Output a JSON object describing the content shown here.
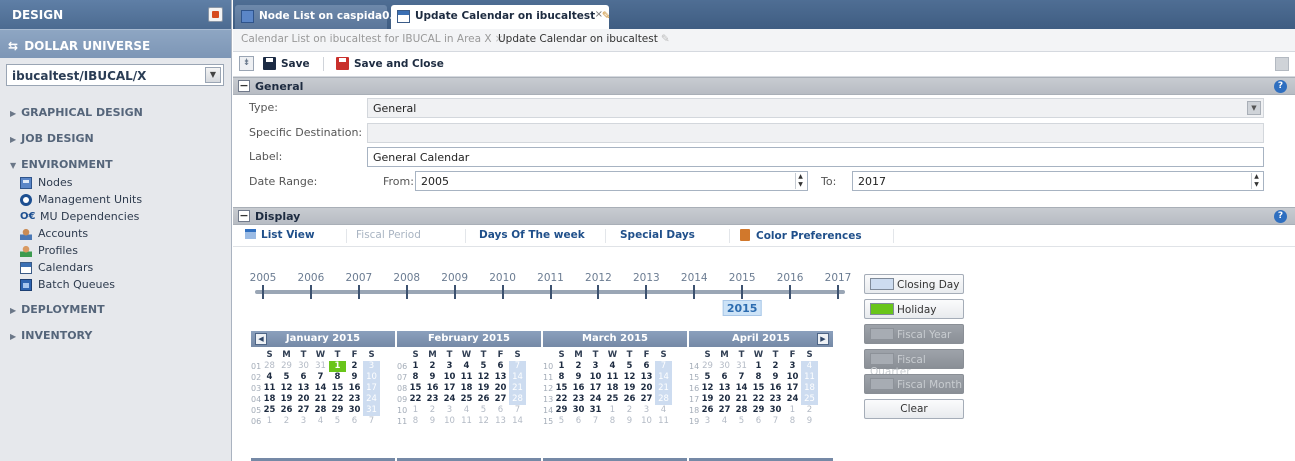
{
  "sidebar": {
    "header": "DESIGN",
    "brand": "DOLLAR UNIVERSE",
    "node_selector": "ibucaltest/IBUCAL/X",
    "sections": {
      "graphical_design": "GRAPHICAL DESIGN",
      "job_design": "JOB DESIGN",
      "environment": "ENVIRONMENT",
      "deployment": "DEPLOYMENT",
      "inventory": "INVENTORY"
    },
    "environment_items": [
      "Nodes",
      "Management Units",
      "MU Dependencies",
      "Accounts",
      "Profiles",
      "Calendars",
      "Batch Queues"
    ]
  },
  "tabs": [
    {
      "label": "Node List on caspida0..."
    },
    {
      "label": "Update Calendar on ibucaltest"
    }
  ],
  "breadcrumb": [
    "Calendar List on ibucaltest for IBUCAL in Area X",
    "Update Calendar on ibucaltest"
  ],
  "toolbar": {
    "save": "Save",
    "save_close": "Save and Close"
  },
  "general": {
    "title": "General",
    "type_label": "Type:",
    "type_value": "General",
    "dest_label": "Specific Destination:",
    "dest_value": "",
    "label_label": "Label:",
    "label_value": "General Calendar",
    "range_label": "Date Range:",
    "from_label": "From:",
    "from_value": "2005",
    "to_label": "To:",
    "to_value": "2017"
  },
  "display": {
    "title": "Display",
    "tabs": [
      "List View",
      "Fiscal Period",
      "Days Of The week",
      "Special Days",
      "Color Preferences"
    ]
  },
  "timeline": {
    "years": [
      "2005",
      "2006",
      "2007",
      "2008",
      "2009",
      "2010",
      "2011",
      "2012",
      "2013",
      "2014",
      "2015",
      "2016",
      "2017"
    ],
    "current": "2015"
  },
  "legend": {
    "closing_day": "Closing Day",
    "holiday": "Holiday",
    "fiscal_year": "Fiscal Year",
    "fiscal_quarter": "Fiscal Quarter",
    "fiscal_month": "Fiscal Month",
    "clear": "Clear",
    "closing_color": "#cddcf0",
    "holiday_color": "#69c51a"
  },
  "calendar": {
    "day_headers": [
      "S",
      "M",
      "T",
      "W",
      "T",
      "F",
      "S"
    ],
    "months": [
      {
        "name": "January 2015",
        "weeks": [
          "01",
          "02",
          "03",
          "04",
          "05",
          "06"
        ],
        "rows": [
          [
            "28",
            "29",
            "30",
            "31",
            "1",
            "2",
            "3"
          ],
          [
            "4",
            "5",
            "6",
            "7",
            "8",
            "9",
            "10"
          ],
          [
            "11",
            "12",
            "13",
            "14",
            "15",
            "16",
            "17"
          ],
          [
            "18",
            "19",
            "20",
            "21",
            "22",
            "23",
            "24"
          ],
          [
            "25",
            "26",
            "27",
            "28",
            "29",
            "30",
            "31"
          ],
          [
            "1",
            "2",
            "3",
            "4",
            "5",
            "6",
            "7"
          ]
        ],
        "other": [
          [
            1,
            1,
            1,
            1,
            0,
            0,
            0
          ],
          [
            0,
            0,
            0,
            0,
            0,
            0,
            0
          ],
          [
            0,
            0,
            0,
            0,
            0,
            0,
            0
          ],
          [
            0,
            0,
            0,
            0,
            0,
            0,
            0
          ],
          [
            0,
            0,
            0,
            0,
            0,
            0,
            0
          ],
          [
            1,
            1,
            1,
            1,
            1,
            1,
            1
          ]
        ],
        "today": [
          0,
          4
        ]
      },
      {
        "name": "February 2015",
        "weeks": [
          "06",
          "07",
          "08",
          "09",
          "10",
          "11"
        ],
        "rows": [
          [
            "1",
            "2",
            "3",
            "4",
            "5",
            "6",
            "7"
          ],
          [
            "8",
            "9",
            "10",
            "11",
            "12",
            "13",
            "14"
          ],
          [
            "15",
            "16",
            "17",
            "18",
            "19",
            "20",
            "21"
          ],
          [
            "22",
            "23",
            "24",
            "25",
            "26",
            "27",
            "28"
          ],
          [
            "1",
            "2",
            "3",
            "4",
            "5",
            "6",
            "7"
          ],
          [
            "8",
            "9",
            "10",
            "11",
            "12",
            "13",
            "14"
          ]
        ],
        "other": [
          [
            0,
            0,
            0,
            0,
            0,
            0,
            0
          ],
          [
            0,
            0,
            0,
            0,
            0,
            0,
            0
          ],
          [
            0,
            0,
            0,
            0,
            0,
            0,
            0
          ],
          [
            0,
            0,
            0,
            0,
            0,
            0,
            0
          ],
          [
            1,
            1,
            1,
            1,
            1,
            1,
            1
          ],
          [
            1,
            1,
            1,
            1,
            1,
            1,
            1
          ]
        ]
      },
      {
        "name": "March 2015",
        "weeks": [
          "10",
          "11",
          "12",
          "13",
          "14",
          "15"
        ],
        "rows": [
          [
            "1",
            "2",
            "3",
            "4",
            "5",
            "6",
            "7"
          ],
          [
            "8",
            "9",
            "10",
            "11",
            "12",
            "13",
            "14"
          ],
          [
            "15",
            "16",
            "17",
            "18",
            "19",
            "20",
            "21"
          ],
          [
            "22",
            "23",
            "24",
            "25",
            "26",
            "27",
            "28"
          ],
          [
            "29",
            "30",
            "31",
            "1",
            "2",
            "3",
            "4"
          ],
          [
            "5",
            "6",
            "7",
            "8",
            "9",
            "10",
            "11"
          ]
        ],
        "other": [
          [
            0,
            0,
            0,
            0,
            0,
            0,
            0
          ],
          [
            0,
            0,
            0,
            0,
            0,
            0,
            0
          ],
          [
            0,
            0,
            0,
            0,
            0,
            0,
            0
          ],
          [
            0,
            0,
            0,
            0,
            0,
            0,
            0
          ],
          [
            0,
            0,
            0,
            1,
            1,
            1,
            1
          ],
          [
            1,
            1,
            1,
            1,
            1,
            1,
            1
          ]
        ]
      },
      {
        "name": "April 2015",
        "weeks": [
          "14",
          "15",
          "16",
          "17",
          "18",
          "19"
        ],
        "rows": [
          [
            "29",
            "30",
            "31",
            "1",
            "2",
            "3",
            "4"
          ],
          [
            "5",
            "6",
            "7",
            "8",
            "9",
            "10",
            "11"
          ],
          [
            "12",
            "13",
            "14",
            "15",
            "16",
            "17",
            "18"
          ],
          [
            "19",
            "20",
            "21",
            "22",
            "23",
            "24",
            "25"
          ],
          [
            "26",
            "27",
            "28",
            "29",
            "30",
            "1",
            "2"
          ],
          [
            "3",
            "4",
            "5",
            "6",
            "7",
            "8",
            "9"
          ]
        ],
        "other": [
          [
            1,
            1,
            1,
            0,
            0,
            0,
            0
          ],
          [
            0,
            0,
            0,
            0,
            0,
            0,
            0
          ],
          [
            0,
            0,
            0,
            0,
            0,
            0,
            0
          ],
          [
            0,
            0,
            0,
            0,
            0,
            0,
            0
          ],
          [
            0,
            0,
            0,
            0,
            0,
            1,
            1
          ],
          [
            1,
            1,
            1,
            1,
            1,
            1,
            1
          ]
        ]
      }
    ]
  }
}
